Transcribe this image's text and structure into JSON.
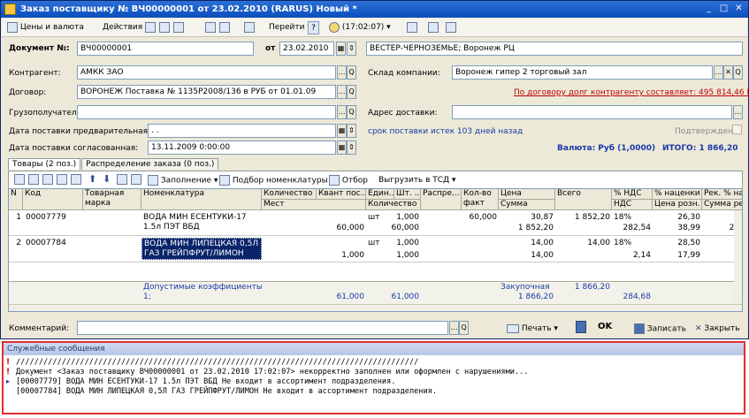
{
  "window": {
    "title": "Заказ поставщику № ВЧ00000001 от 23.02.2010 (RARUS) Новый *",
    "min_btn": "_",
    "max_btn": "□",
    "close_btn": "✕"
  },
  "toolbar": {
    "prices": "Цены и валюта",
    "actions": "Действия ▾",
    "goto": "Перейти ▾",
    "help": "?",
    "time": "(17:02:07) ▾"
  },
  "header": {
    "doc_no_label": "Документ №:",
    "doc_no": "ВЧ00000001",
    "date_label": "от",
    "date": "23.02.2010",
    "org": "ВЕСТЕР-ЧЕРНОЗЕМЬЕ; Воронеж РЦ",
    "contragent_label": "Контрагент:",
    "contragent": "АМКК ЗАО",
    "warehouse_label": "Склад компании:",
    "warehouse": "Воронеж гипер 2 торговый зал",
    "contract_label": "Договор:",
    "contract": "ВОРОНЕЖ Поставка № 1135Р2008/136 в РУБ от 01.01.09",
    "debt_link": "По договору долг контрагенту составляет: 495 814,46 Руб",
    "consignee_label": "Грузополучатель:",
    "consignee": "",
    "address_label": "Адрес доставки:",
    "address": "",
    "prelim_date_label": "Дата поставки предварительная:",
    "prelim_date": ". .",
    "confirmed_label": "Подтвержден",
    "agreed_date_label": "Дата поставки согласованная:",
    "agreed_date": "13.11.2009 0:00:00",
    "expired_text": "срок поставки истек 103 дней назад",
    "currency": "Валюта: Руб (1,0000)",
    "total": "ИТОГО: 1 866,20"
  },
  "tabs": [
    "Товары (2 поз.)",
    "Распределение заказа (0 поз.)"
  ],
  "grid_toolbar": {
    "fill": "Заполнение ▾",
    "pick": "Подбор номенклатуры",
    "filter": "Отбор",
    "export": "Выгрузить в ТСД ▾"
  },
  "grid": {
    "headers_top": [
      "N",
      "Код",
      "Товарная марка",
      "Номенклатура",
      "Количество ...",
      "Квант пос...",
      "Един...",
      "Шт. ...",
      "Распре...",
      "Кол-во факт",
      "Цена",
      "Всего",
      "% НДС",
      "% наценки",
      "Рек. % на"
    ],
    "headers_bottom": [
      "",
      "",
      "",
      "",
      "Мест",
      "",
      "Количество",
      "",
      "",
      "",
      "Сумма",
      "",
      "НДС",
      "Цена розн.",
      "Сумма ре"
    ],
    "rows": [
      {
        "n": "1",
        "code": "00007779",
        "name": "ВОДА МИН ЕСЕНТУКИ-17 1.5л ПЭТ ВБД",
        "qty_b": "60,000",
        "unit": "шт",
        "pcs": "1,000",
        "qty2": "60,000",
        "fact": "60,000",
        "price": "30,87",
        "sum": "1 852,20",
        "total": "1 852,20",
        "vat_pct": "18%",
        "vat": "282,54",
        "markup": "26,30",
        "retail": "38,99",
        "rec": "2 3"
      },
      {
        "n": "2",
        "code": "00007784",
        "name": "ВОДА МИН ЛИПЕЦКАЯ 0,5Л ГАЗ ГРЕЙПФРУТ/ЛИМОН",
        "qty_b": "1,000",
        "unit": "шт",
        "pcs": "1,000",
        "qty2": "1,000",
        "fact": "",
        "price": "14,00",
        "sum": "14,00",
        "total": "14,00",
        "vat_pct": "18%",
        "vat": "2,14",
        "markup": "28,50",
        "retail": "17,99",
        "rec": ""
      }
    ],
    "footer": {
      "coef_label": "Допустимые коэффициенты:",
      "coef": "1;",
      "qty_total": "61,000",
      "qty2_total": "61,000",
      "purchase_label": "Закупочная",
      "purchase_sum": "1 866,20",
      "total": "1 866,20",
      "vat_total": "284,68"
    }
  },
  "bottom": {
    "comment_label": "Комментарий:",
    "print": "Печать ▾",
    "ok": "OK",
    "save": "Записать",
    "close": "Закрыть"
  },
  "messages": {
    "title": "Служебные сообщения",
    "lines": [
      "////////////////////////////////////////////////////////////////////////////////////////",
      "Документ <Заказ поставщику ВЧ00000001 от 23.02.2010 17:02:07> некорректно заполнен или оформлен с нарушениями...",
      "[00007779] ВОДА МИН ЕСЕНТУКИ-17 1.5л ПЭТ ВБД Не входит в ассортимент подразделения.",
      "[00007784] ВОДА МИН ЛИПЕЦКАЯ 0,5Л ГАЗ ГРЕЙПФРУТ/ЛИМОН Не входит в ассортимент подразделения."
    ]
  },
  "colors": {
    "titlebar": "#0b4fbd",
    "message_border": "#e03030",
    "selection": "#0a246a"
  }
}
